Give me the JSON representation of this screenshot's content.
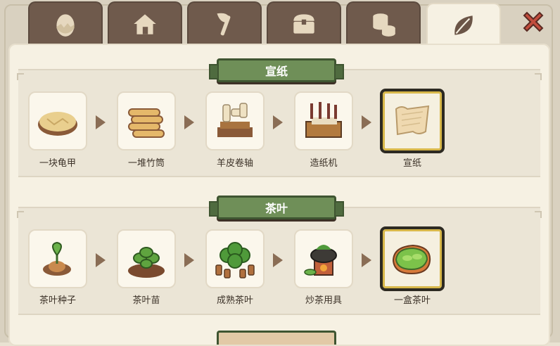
{
  "tabs": [
    {
      "icon": "egg-icon",
      "active": false
    },
    {
      "icon": "house-icon",
      "active": false
    },
    {
      "icon": "axe-icon",
      "active": false
    },
    {
      "icon": "chest-icon",
      "active": false
    },
    {
      "icon": "coins-icon",
      "active": false
    },
    {
      "icon": "leaf-icon",
      "active": true
    }
  ],
  "close": {
    "icon": "close-icon"
  },
  "recipes": [
    {
      "title": "宣纸",
      "steps": [
        {
          "label": "一块龟甲",
          "icon": "turtle-shell-icon"
        },
        {
          "label": "一堆竹筒",
          "icon": "bamboo-pile-icon"
        },
        {
          "label": "羊皮卷轴",
          "icon": "scroll-rack-icon"
        },
        {
          "label": "造纸机",
          "icon": "paper-machine-icon"
        },
        {
          "label": "宣纸",
          "icon": "xuan-paper-icon",
          "final": true
        }
      ]
    },
    {
      "title": "茶叶",
      "steps": [
        {
          "label": "茶叶种子",
          "icon": "tea-seed-icon"
        },
        {
          "label": "茶叶苗",
          "icon": "tea-seedling-icon"
        },
        {
          "label": "成熟茶叶",
          "icon": "mature-tea-icon"
        },
        {
          "label": "炒茶用具",
          "icon": "tea-roaster-icon"
        },
        {
          "label": "一盒茶叶",
          "icon": "tea-box-icon",
          "final": true
        }
      ]
    }
  ],
  "colors": {
    "banner": "#6f8f58",
    "tab": "#6f5a4c",
    "tab_active": "#f6f1e3",
    "arrow": "#8a6d55",
    "close": "#c24d3d"
  }
}
